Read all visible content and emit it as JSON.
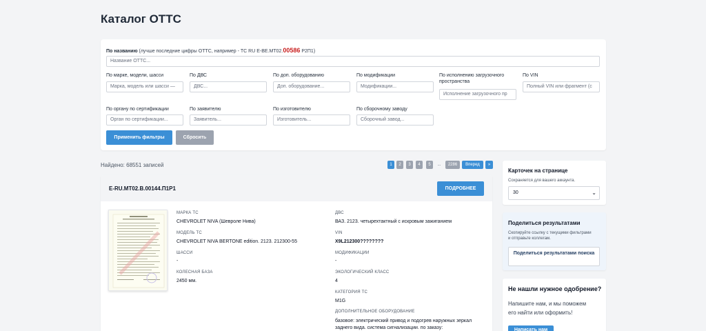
{
  "page": {
    "title": "Каталог ОТТС"
  },
  "filters": {
    "name": {
      "label": "По названию",
      "hint_prefix": "(лучше последние цифры ОТТС, например - ТС RU E-BE.MT02.",
      "hint_red": "00586",
      "hint_suffix": "Р2П1)",
      "placeholder": "Название ОТТС..."
    },
    "brand": {
      "label": "По марке, модели, шасси",
      "placeholder": "Марка, модель или шасси —"
    },
    "engine": {
      "label": "По ДВС",
      "placeholder": "ДВС..."
    },
    "equipment": {
      "label": "По доп. оборудованию",
      "placeholder": "Доп. оборудование..."
    },
    "modification": {
      "label": "По модификации",
      "placeholder": "Модификации..."
    },
    "loading": {
      "label": "По исполнению загрузочного пространства",
      "placeholder": "Исполнение загрузочного пр"
    },
    "vin": {
      "label": "По VIN",
      "placeholder": "Полный VIN или фрагмент (с"
    },
    "cert_body": {
      "label": "По органу по сертификации",
      "placeholder": "Орган по сертификации..."
    },
    "applicant": {
      "label": "По заявителю",
      "placeholder": "Заявитель..."
    },
    "manufacturer": {
      "label": "По изготовителю",
      "placeholder": "Изготовитель..."
    },
    "assembly": {
      "label": "По сборочному заводу",
      "placeholder": "Сборочный завод..."
    },
    "apply_label": "Применить фильтры",
    "reset_label": "Сбросить"
  },
  "results": {
    "found_text": "Найдено: 68551 записей",
    "pages": [
      "1",
      "2",
      "3",
      "4",
      "5"
    ],
    "dots": "...",
    "last_page": "2286",
    "next_label": "Вперед",
    "next_arrow": "»"
  },
  "card": {
    "number": "E-RU.MT02.B.00144.П1P1",
    "more_label": "ПОДРОБНЕЕ",
    "left_fields": [
      {
        "key": "МАРКА ТС",
        "value": "CHEVROLET NIVA (Шевроле Нива)"
      },
      {
        "key": "МОДЕЛЬ ТС",
        "value": "CHEVROLET NIVA BERTONE edition. 2123. 212300-55"
      },
      {
        "key": "ШАССИ",
        "value": "-"
      },
      {
        "key": "КОЛЕСНАЯ БАЗА",
        "value": "2450 мм."
      }
    ],
    "right_fields": [
      {
        "key": "ДВС",
        "value": "ВАЗ. 2123. четырехтактный с искровым зажиганием"
      },
      {
        "key": "VIN",
        "value": "X9L212300????????"
      },
      {
        "key": "МОДИФИКАЦИИ",
        "value": "-"
      },
      {
        "key": "ЭКОЛОГИЧЕСКИЙ КЛАСС",
        "value": "4"
      },
      {
        "key": "КАТЕГОРИЯ ТС",
        "value": "M1G"
      },
      {
        "key": "ДОПОЛНИТЕЛЬНОЕ ОБОРУДОВАНИЕ",
        "value": "базовое: электрический привод и подогрев наружных зеркал заднего вида. система сигнализации. по заказу:"
      }
    ]
  },
  "sidebar": {
    "per_page": {
      "title": "Карточек на странице",
      "note": "Сохраняется для вашего аккаунта.",
      "value": "30"
    },
    "share": {
      "title": "Поделиться результатами",
      "note": "Скопируйте ссылку с текущими фильтрами и отправьте коллегам.",
      "button_label": "Поделиться результатами поиска"
    },
    "contact": {
      "title": "Не нашли нужное одобрение?",
      "text": "Напишите нам, и мы поможем его найти или оформить!",
      "button_label": "Написать нам"
    }
  }
}
